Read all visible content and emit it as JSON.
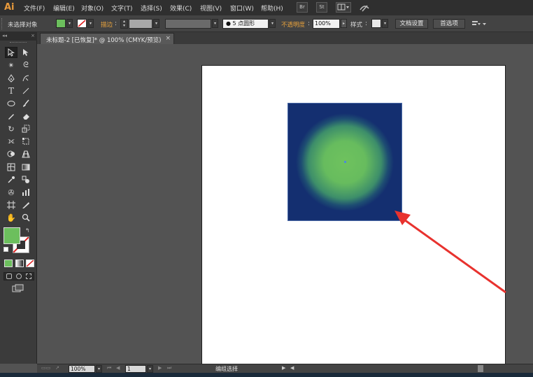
{
  "app": {
    "logo": "Ai"
  },
  "menu": [
    "文件(F)",
    "编辑(E)",
    "对象(O)",
    "文字(T)",
    "选择(S)",
    "效果(C)",
    "视图(V)",
    "窗口(W)",
    "帮助(H)"
  ],
  "menubar_buttons": {
    "br": "Br",
    "st": "St"
  },
  "controlbar": {
    "selection_status": "未选择对象",
    "fill_color": "#6cbf5d",
    "stroke_label": "描边",
    "brush_label": "5 点圆形",
    "opacity_label": "不透明度",
    "opacity_value": "100%",
    "style_label": "样式",
    "doc_setup": "文档设置",
    "preferences": "首选项"
  },
  "document": {
    "tab_title": "未标题-2 [已恢复]* @ 100% (CMYK/预览)",
    "close_glyph": "×"
  },
  "tools": {
    "fill_color": "#6cbf5d"
  },
  "canvas": {
    "square_dark": "#142f70",
    "gradient_center": "#6fc25e",
    "arrow_color": "#e8322e"
  },
  "statusbar": {
    "zoom": "100%",
    "artboard": "1",
    "status": "编组选择"
  }
}
